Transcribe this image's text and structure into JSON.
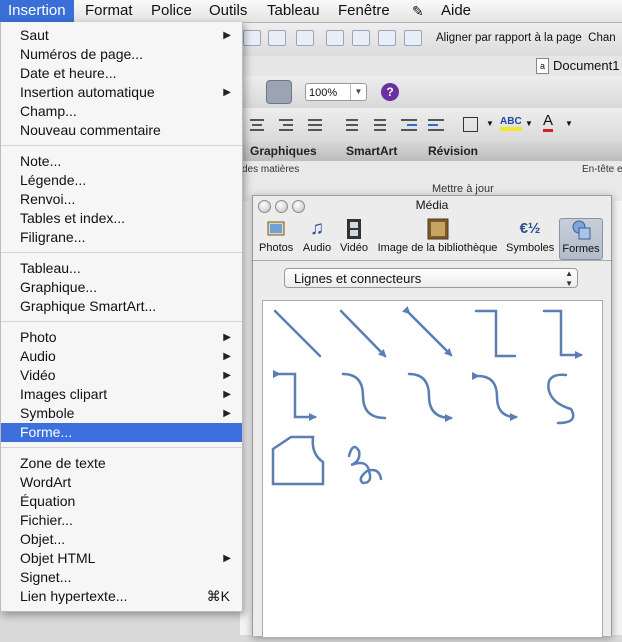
{
  "menubar": {
    "items": [
      "Insertion",
      "Format",
      "Police",
      "Outils",
      "Tableau",
      "Fenêtre",
      "Aide"
    ],
    "script_icon": "applescript-icon"
  },
  "app": {
    "align_label": "Aligner par rapport à la page",
    "align_label_cut": "Chan",
    "document_title": "Document1",
    "zoom": "100%",
    "help": "?",
    "ribbon_tabs": [
      "Graphiques",
      "SmartArt",
      "Révision"
    ],
    "ribbon_labels": [
      "des matières",
      "Mettre à jour",
      "En-tête e"
    ]
  },
  "menu": {
    "groups": [
      [
        {
          "label": "Saut",
          "submenu": true
        },
        {
          "label": "Numéros de page..."
        },
        {
          "label": "Date et heure..."
        },
        {
          "label": "Insertion automatique",
          "submenu": true
        },
        {
          "label": "Champ..."
        },
        {
          "label": "Nouveau commentaire"
        }
      ],
      [
        {
          "label": "Note..."
        },
        {
          "label": "Légende..."
        },
        {
          "label": "Renvoi..."
        },
        {
          "label": "Tables et index..."
        },
        {
          "label": "Filigrane..."
        }
      ],
      [
        {
          "label": "Tableau..."
        },
        {
          "label": "Graphique..."
        },
        {
          "label": "Graphique SmartArt..."
        }
      ],
      [
        {
          "label": "Photo",
          "submenu": true
        },
        {
          "label": "Audio",
          "submenu": true
        },
        {
          "label": "Vidéo",
          "submenu": true
        },
        {
          "label": "Images clipart",
          "submenu": true
        },
        {
          "label": "Symbole",
          "submenu": true
        },
        {
          "label": "Forme...",
          "highlighted": true
        }
      ],
      [
        {
          "label": "Zone de texte"
        },
        {
          "label": "WordArt"
        },
        {
          "label": "Équation"
        },
        {
          "label": "Fichier..."
        },
        {
          "label": "Objet..."
        },
        {
          "label": "Objet HTML",
          "submenu": true
        },
        {
          "label": "Signet..."
        },
        {
          "label": "Lien hypertexte...",
          "shortcut": "⌘K"
        }
      ]
    ]
  },
  "media": {
    "title": "Média",
    "tabs": [
      {
        "label": "Photos",
        "icon": "photos-icon"
      },
      {
        "label": "Audio",
        "icon": "music-note-icon"
      },
      {
        "label": "Vidéo",
        "icon": "film-icon"
      },
      {
        "label": "Image de la bibliothèque",
        "icon": "picture-library-icon"
      },
      {
        "label": "Symboles",
        "icon": "symbols-icon",
        "glyph": "€½"
      },
      {
        "label": "Formes",
        "icon": "shapes-icon",
        "selected": true
      }
    ],
    "category": "Lignes et connecteurs",
    "shapes": [
      "line",
      "line-arrow",
      "line-double-arrow",
      "elbow-connector",
      "elbow-arrow",
      "elbow-double-arrow",
      "curved-connector",
      "curved-arrow",
      "curved-double-arrow",
      "curve",
      "freeform",
      "scribble"
    ]
  },
  "colors": {
    "highlight": "#3d6fdd",
    "shape_stroke": "#5b7fb5"
  }
}
